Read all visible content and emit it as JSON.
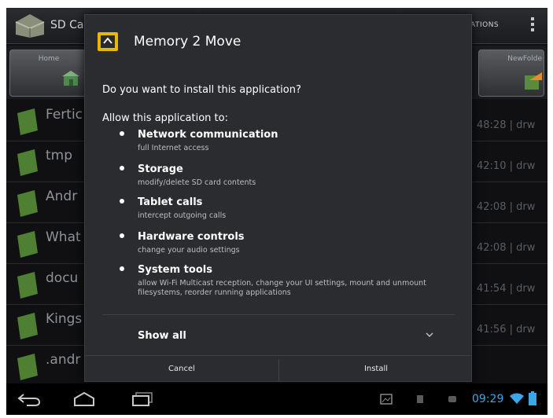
{
  "app": {
    "title": "SD Car",
    "header_right_label": "ATIONS"
  },
  "toolbar": {
    "home_label": "Home",
    "newfolder_label": "NewFolde"
  },
  "files": [
    {
      "name": "Fertic",
      "meta": "48:28 | drw"
    },
    {
      "name": "tmp",
      "meta": "42:10 | drw"
    },
    {
      "name": "Andr",
      "meta": "42:08 | drw"
    },
    {
      "name": "What",
      "meta": "42:08 | drw"
    },
    {
      "name": "docu",
      "meta": "41:54 | drw"
    },
    {
      "name": "Kings",
      "meta": "41:56 | drw"
    },
    {
      "name": ".andr",
      "meta": ""
    }
  ],
  "dialog": {
    "title": "Memory 2 Move",
    "question": "Do you want to install this application?",
    "allow_label": "Allow this application to:",
    "permissions": [
      {
        "title": "Network communication",
        "desc": "full Internet access"
      },
      {
        "title": "Storage",
        "desc": "modify/delete SD card contents"
      },
      {
        "title": "Tablet calls",
        "desc": "intercept outgoing calls"
      },
      {
        "title": "Hardware controls",
        "desc": "change your audio settings"
      },
      {
        "title": "System tools",
        "desc": "allow Wi-Fi Multicast reception, change your UI settings, mount and unmount filesystems, reorder running applications"
      }
    ],
    "show_all_label": "Show all",
    "cancel_label": "Cancel",
    "install_label": "Install"
  },
  "status": {
    "time": "09:29",
    "accent": "#3aa7e8"
  }
}
